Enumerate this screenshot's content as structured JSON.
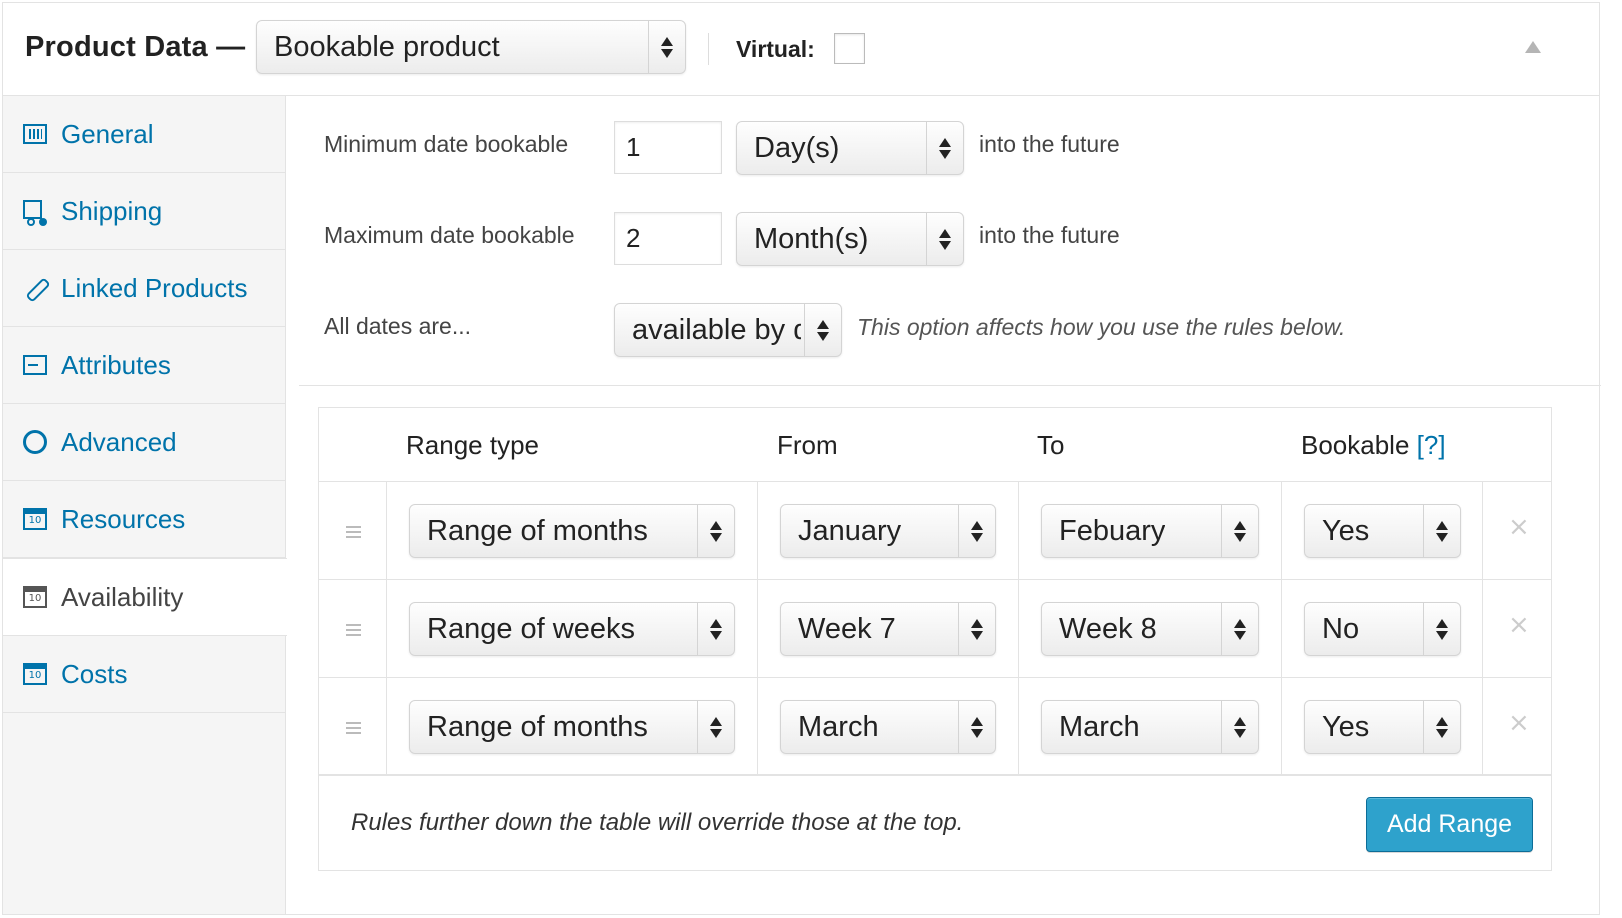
{
  "header": {
    "title": "Product Data —",
    "product_type": "Bookable product",
    "virtual_label": "Virtual:",
    "virtual_checked": false
  },
  "sidebar": {
    "items": [
      {
        "label": "General",
        "icon": "barcode-icon"
      },
      {
        "label": "Shipping",
        "icon": "truck-icon"
      },
      {
        "label": "Linked Products",
        "icon": "link-icon"
      },
      {
        "label": "Attributes",
        "icon": "list-icon"
      },
      {
        "label": "Advanced",
        "icon": "gear-icon"
      },
      {
        "label": "Resources",
        "icon": "calendar-icon"
      },
      {
        "label": "Availability",
        "icon": "calendar-icon",
        "active": true
      },
      {
        "label": "Costs",
        "icon": "calendar-icon"
      }
    ]
  },
  "options": {
    "min": {
      "label": "Minimum date bookable",
      "value": "1",
      "unit": "Day(s)",
      "suffix": "into the future"
    },
    "max": {
      "label": "Maximum date bookable",
      "value": "2",
      "unit": "Month(s)",
      "suffix": "into the future"
    },
    "all_dates": {
      "label": "All dates are...",
      "value": "available by default",
      "hint": "This option affects how you use the rules below."
    }
  },
  "table": {
    "headers": {
      "range_type": "Range type",
      "from": "From",
      "to": "To",
      "bookable": "Bookable",
      "help": "[?]"
    },
    "rows": [
      {
        "range_type": "Range of months",
        "from": "January",
        "to": "Febuary",
        "bookable": "Yes"
      },
      {
        "range_type": "Range of weeks",
        "from": "Week 7",
        "to": "Week 8",
        "bookable": "No"
      },
      {
        "range_type": "Range of months",
        "from": "March",
        "to": "March",
        "bookable": "Yes"
      }
    ],
    "footer_note": "Rules further down the table will override those at the top.",
    "add_button": "Add Range",
    "remove_glyph": "×"
  },
  "colors": {
    "link": "#0073aa",
    "primary_button": "#2ea2cc"
  }
}
